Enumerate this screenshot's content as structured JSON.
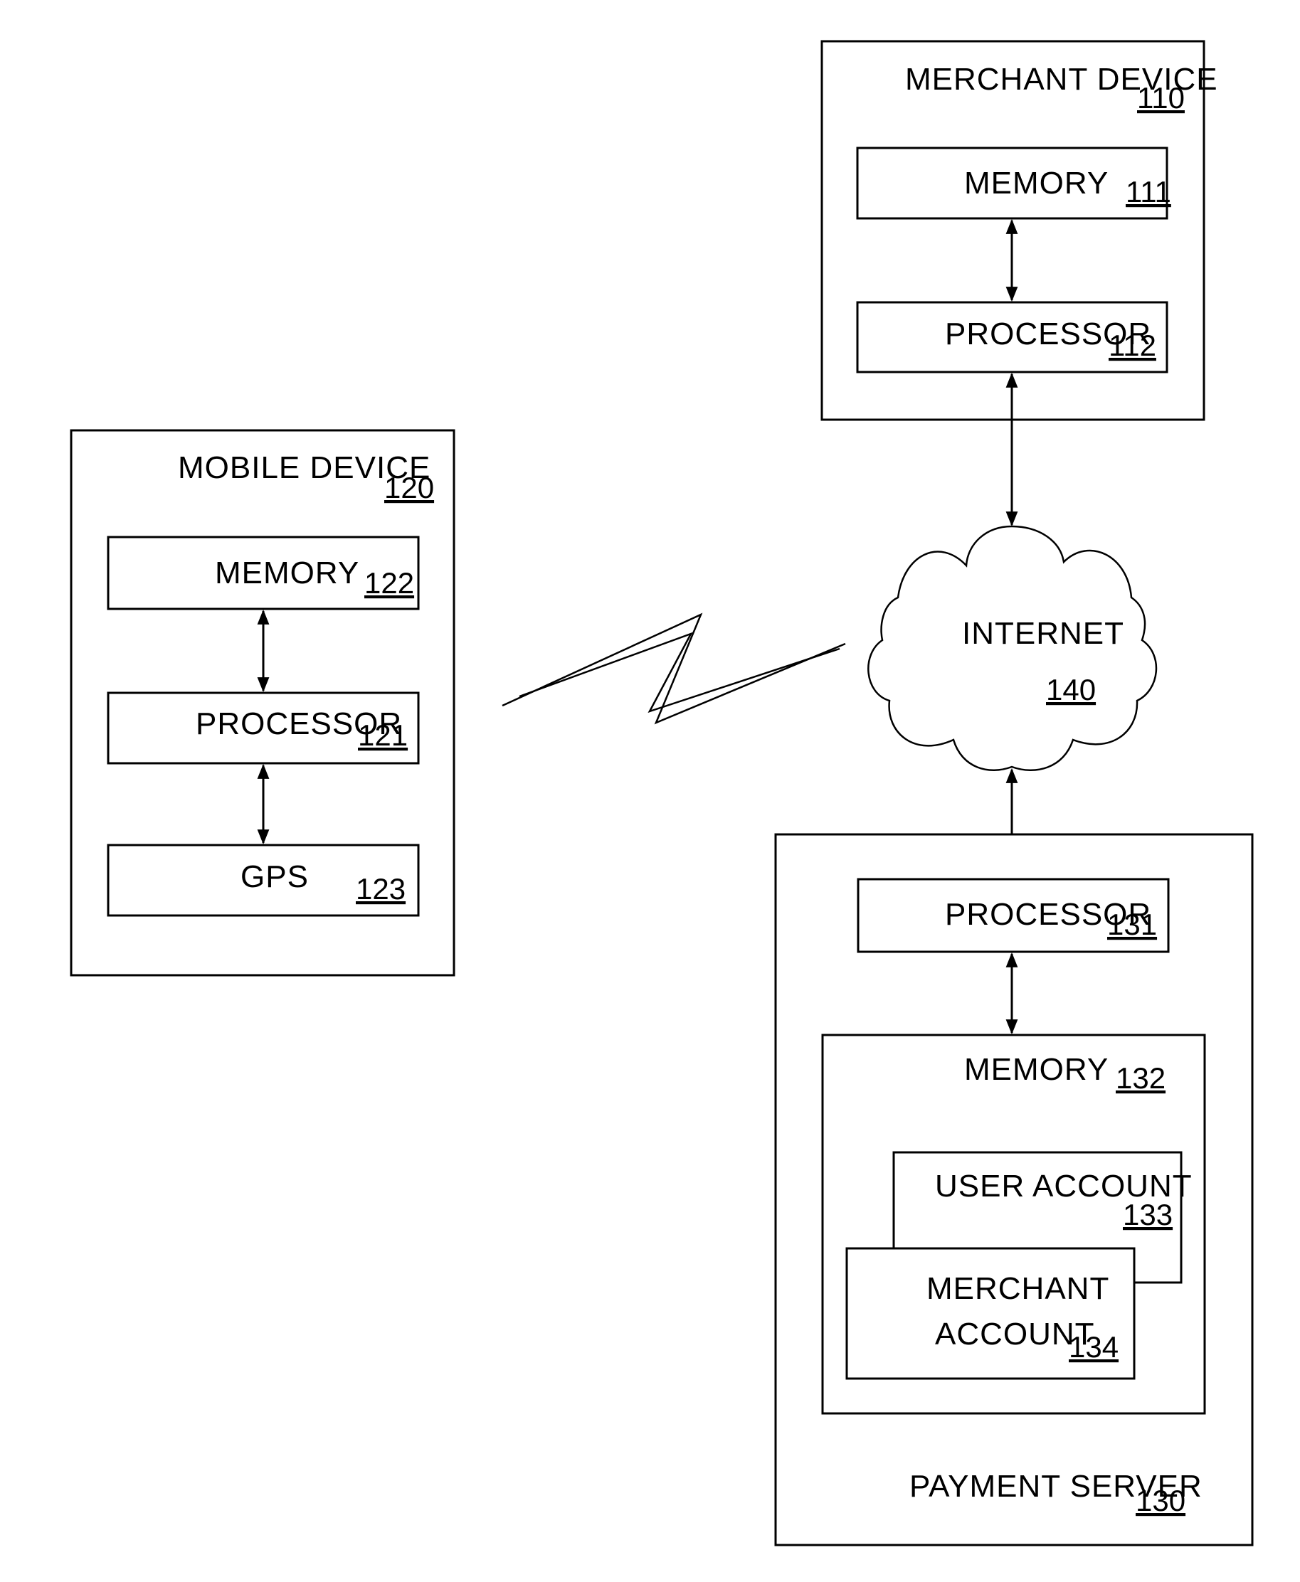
{
  "diagram": {
    "merchant_device": {
      "label": "MERCHANT DEVICE",
      "ref": "110",
      "memory": {
        "label": "MEMORY",
        "ref": "111"
      },
      "processor": {
        "label": "PROCESSOR",
        "ref": "112"
      }
    },
    "mobile_device": {
      "label": "MOBILE DEVICE",
      "ref": "120",
      "memory": {
        "label": "MEMORY",
        "ref": "122"
      },
      "processor": {
        "label": "PROCESSOR",
        "ref": "121"
      },
      "gps": {
        "label": "GPS",
        "ref": "123"
      }
    },
    "internet": {
      "label": "INTERNET",
      "ref": "140"
    },
    "payment_server": {
      "label": "PAYMENT SERVER",
      "ref": "130",
      "processor": {
        "label": "PROCESSOR",
        "ref": "131"
      },
      "memory": {
        "label": "MEMORY",
        "ref": "132"
      },
      "user_account": {
        "label": "USER ACCOUNT",
        "ref": "133"
      },
      "merchant_account": {
        "label_line1": "MERCHANT",
        "label_line2": "ACCOUNT",
        "ref": "134"
      }
    },
    "connections": [
      {
        "from": "memory-111",
        "to": "processor-112",
        "type": "bidirectional"
      },
      {
        "from": "processor-112",
        "to": "internet-140",
        "type": "bidirectional"
      },
      {
        "from": "memory-122",
        "to": "processor-121",
        "type": "bidirectional"
      },
      {
        "from": "processor-121",
        "to": "gps-123",
        "type": "bidirectional"
      },
      {
        "from": "mobile-device-120",
        "to": "internet-140",
        "type": "wireless"
      },
      {
        "from": "internet-140",
        "to": "processor-131",
        "type": "bidirectional"
      },
      {
        "from": "processor-131",
        "to": "memory-132",
        "type": "bidirectional"
      }
    ]
  }
}
